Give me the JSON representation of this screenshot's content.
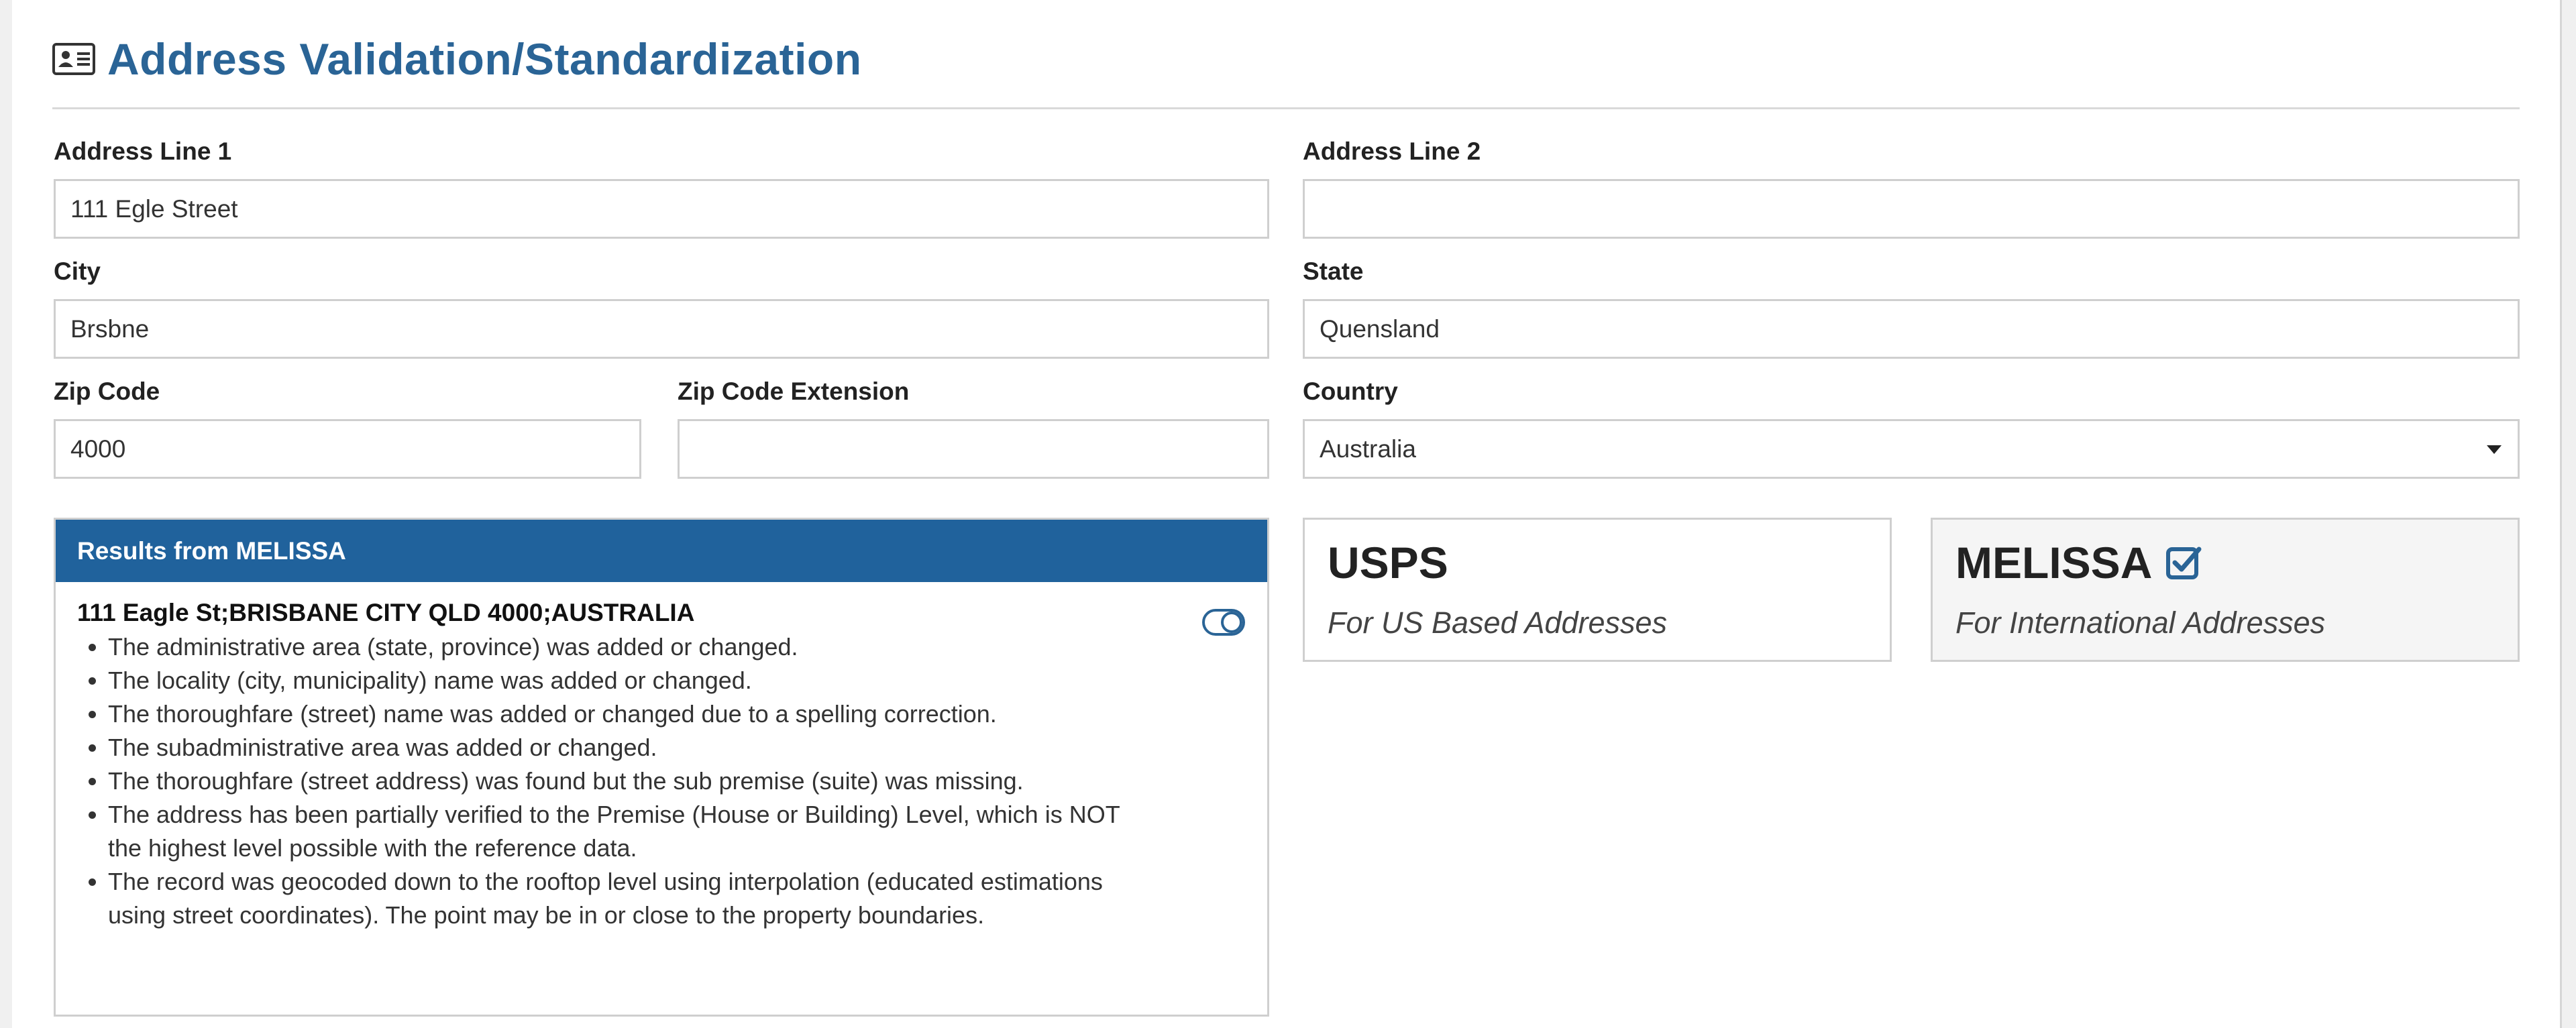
{
  "header": {
    "icon": "address-card-icon",
    "title": "Address Validation/Standardization"
  },
  "form": {
    "address_line1": {
      "label": "Address Line 1",
      "value": "111 Egle Street"
    },
    "address_line2": {
      "label": "Address Line 2",
      "value": ""
    },
    "city": {
      "label": "City",
      "value": "Brsbne"
    },
    "state": {
      "label": "State",
      "value": "Quensland"
    },
    "zip": {
      "label": "Zip Code",
      "value": "4000"
    },
    "zip_ext": {
      "label": "Zip Code Extension",
      "value": ""
    },
    "country": {
      "label": "Country",
      "value": "Australia"
    }
  },
  "results": {
    "header": "Results from MELISSA",
    "address": "111 Eagle St;BRISBANE CITY QLD 4000;AUSTRALIA",
    "items": [
      "The administrative area (state, province) was added or changed.",
      "The locality (city, municipality) name was added or changed.",
      "The thoroughfare (street) name was added or changed due to a spelling correction.",
      "The subadministrative area was added or changed.",
      "The thoroughfare (street address) was found but the sub premise (suite) was missing.",
      "The address has been partially verified to the Premise (House or Building) Level, which is NOT the highest level possible with the reference data.",
      "The record was geocoded down to the rooftop level using interpolation (educated estimations using street coordinates). The point may be in or close to the property boundaries."
    ]
  },
  "providers": {
    "usps": {
      "title": "USPS",
      "subtitle": "For US Based Addresses",
      "selected": false
    },
    "melissa": {
      "title": "MELISSA",
      "subtitle": "For International Addresses",
      "selected": true
    }
  },
  "colors": {
    "accent": "#2a6496",
    "results_header_bg": "#20629c",
    "border": "#cfcfcf"
  }
}
